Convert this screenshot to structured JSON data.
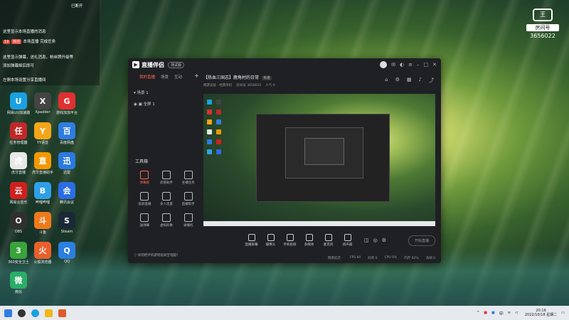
{
  "overlay": {
    "lines": [
      "这里显示本场直播的消息",
      "本场直播 完成任务",
      "这里显示弹幕，送礼消息，粉丝牌升级等",
      "添加弹幕姬后即可",
      "左侧本场设置分享直播间"
    ],
    "badge_labels": [
      "19",
      "粉丝"
    ],
    "top_right_text": "已断开"
  },
  "desktop_icons": [
    {
      "label": "网易UU加速器",
      "color": "#1aa1e0",
      "glyph": "U"
    },
    {
      "label": "Xpadder",
      "color": "#444",
      "glyph": "X"
    },
    {
      "label": "游戏加加平台",
      "color": "#e03030",
      "glyph": "G"
    },
    {
      "label": "任务管理器",
      "color": "#c02828",
      "glyph": "任"
    },
    {
      "label": "YY语音",
      "color": "#f2a619",
      "glyph": "Y"
    },
    {
      "label": "百度网盘",
      "color": "#2f7de1",
      "glyph": "百"
    },
    {
      "label": "虎牙直播",
      "color": "#e8e8e8",
      "glyph": "虎"
    },
    {
      "label": "虎牙直播助手",
      "color": "#f39800",
      "glyph": "直"
    },
    {
      "label": "迅雷",
      "color": "#2a7ae2",
      "glyph": "迅"
    },
    {
      "label": "网易云音乐",
      "color": "#d0201e",
      "glyph": "云"
    },
    {
      "label": "哔哩哔哩",
      "color": "#2ea0e8",
      "glyph": "B"
    },
    {
      "label": "腾讯会议",
      "color": "#2b6de5",
      "glyph": "会"
    },
    {
      "label": "OBS",
      "color": "#303030",
      "glyph": "O"
    },
    {
      "label": "斗鱼",
      "color": "#f07a1a",
      "glyph": "斗"
    },
    {
      "label": "Steam",
      "color": "#1b2838",
      "glyph": "S"
    },
    {
      "label": "360安全卫士",
      "color": "#3aa33a",
      "glyph": "3"
    },
    {
      "label": "火狐浏览器",
      "color": "#e8602c",
      "glyph": "火"
    },
    {
      "label": "QQ",
      "color": "#2b7fe0",
      "glyph": "Q"
    },
    {
      "label": "微信",
      "color": "#2aae67",
      "glyph": "微"
    }
  ],
  "watermark": {
    "title": "房间号",
    "room_id": "3656022",
    "mark": "王"
  },
  "app": {
    "logo_text": "直播伴侣",
    "version_tag": "测试版",
    "tabs": [
      "我的直播",
      "场景",
      "互动"
    ],
    "scene": {
      "name": "场景 1",
      "item": "全屏 1"
    },
    "tools_title": "工具箱",
    "tools": [
      {
        "label": "弹幕姬"
      },
      {
        "label": "房管助手"
      },
      {
        "label": "主播任务"
      },
      {
        "label": "投屏直播"
      },
      {
        "label": "多人连麦"
      },
      {
        "label": "直播帮手"
      },
      {
        "label": "送弹幕"
      },
      {
        "label": "虚拟形象"
      },
      {
        "label": "录播机"
      }
    ],
    "hint": "如何把手机游戏投屏至电脑？",
    "room_title": "【热血三国志】鹿角村的日常",
    "room_tag": "英雄",
    "room_meta": [
      "网游竞技 · 经典单机",
      "房间号 3656022",
      "人气 0"
    ],
    "controls": [
      {
        "label": "直播屏幕"
      },
      {
        "label": "摄像头"
      },
      {
        "label": "手机投屏"
      },
      {
        "label": "多媒体"
      },
      {
        "label": "麦克风"
      },
      {
        "label": "扬声器"
      }
    ],
    "go_live_label": "开始直播",
    "status": [
      "网络延迟 -",
      "FPS 60",
      "码率 0",
      "CPU 6%",
      "内存 62%",
      "丢帧 0"
    ]
  },
  "taskbar": {
    "lang": "中",
    "time": "20:16",
    "date": "2022/10/18 星期二"
  }
}
